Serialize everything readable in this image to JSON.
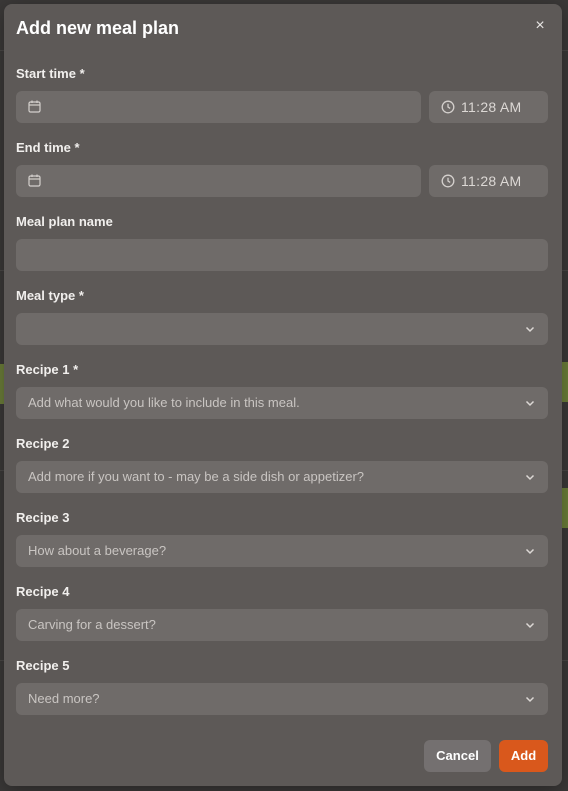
{
  "dialog": {
    "title": "Add new meal plan",
    "close_glyph": "×"
  },
  "form": {
    "start_time": {
      "label": "Start time *",
      "date_value": "",
      "time_value": "11:28 AM"
    },
    "end_time": {
      "label": "End time *",
      "date_value": "",
      "time_value": "11:28 AM"
    },
    "meal_plan_name": {
      "label": "Meal plan name",
      "value": ""
    },
    "meal_type": {
      "label": "Meal type *",
      "value": ""
    },
    "recipes": [
      {
        "label": "Recipe 1 *",
        "placeholder": "Add what would you like to include in this meal."
      },
      {
        "label": "Recipe 2",
        "placeholder": "Add more if you want to - may be a side dish or appetizer?"
      },
      {
        "label": "Recipe 3",
        "placeholder": "How about a beverage?"
      },
      {
        "label": "Recipe 4",
        "placeholder": "Carving for a dessert?"
      },
      {
        "label": "Recipe 5",
        "placeholder": "Need more?"
      }
    ]
  },
  "actions": {
    "cancel_label": "Cancel",
    "add_label": "Add"
  },
  "colors": {
    "modal_bg": "#5d5957",
    "field_bg": "#6f6b69",
    "accent": "#d9581c"
  },
  "icons": [
    "calendar-icon",
    "clock-icon",
    "chevron-down-icon",
    "close-icon"
  ]
}
